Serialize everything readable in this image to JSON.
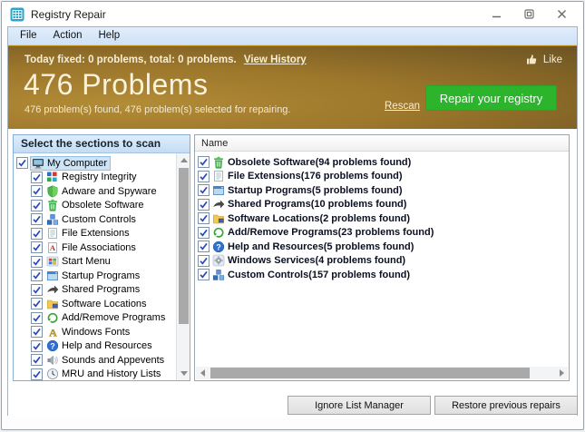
{
  "window": {
    "title": "Registry Repair"
  },
  "titlebar": {
    "app_icon": "registry-grid-icon",
    "controls": [
      {
        "name": "minimize-button",
        "icon": "minimize-icon"
      },
      {
        "name": "maximize-button",
        "icon": "maximize-icon"
      },
      {
        "name": "close-button",
        "icon": "close-icon"
      }
    ]
  },
  "menu": {
    "items": [
      "File",
      "Action",
      "Help"
    ]
  },
  "header": {
    "today_line": "Today fixed: 0 problems, total: 0 problems.",
    "view_history": "View History",
    "like_label": "Like",
    "big_title": "476 Problems",
    "subtitle": "476 problem(s) found, 476 problem(s) selected for repairing.",
    "rescan": "Rescan",
    "repair_button": "Repair your registry",
    "colors": {
      "accent_green": "#2cb52c",
      "brown_left": "#a9822f",
      "brown_right": "#6d5423",
      "text_cream": "#f7efd8"
    }
  },
  "left_panel": {
    "title": "Select the sections to scan",
    "tree": [
      {
        "label": "My Computer",
        "icon": "computer-icon",
        "checked": true,
        "indent": 0,
        "selected": true
      },
      {
        "label": "Registry Integrity",
        "icon": "registry-icon",
        "checked": true,
        "indent": 1
      },
      {
        "label": "Adware and Spyware",
        "icon": "shield-icon",
        "checked": true,
        "indent": 1
      },
      {
        "label": "Obsolete Software",
        "icon": "trash-icon",
        "checked": true,
        "indent": 1
      },
      {
        "label": "Custom Controls",
        "icon": "blocks-icon",
        "checked": true,
        "indent": 1
      },
      {
        "label": "File Extensions",
        "icon": "document-icon",
        "checked": true,
        "indent": 1
      },
      {
        "label": "File Associations",
        "icon": "document-a-icon",
        "checked": true,
        "indent": 1
      },
      {
        "label": "Start Menu",
        "icon": "windows-logo-icon",
        "checked": true,
        "indent": 1
      },
      {
        "label": "Startup Programs",
        "icon": "window-icon",
        "checked": true,
        "indent": 1
      },
      {
        "label": "Shared Programs",
        "icon": "share-arrow-icon",
        "checked": true,
        "indent": 1
      },
      {
        "label": "Software Locations",
        "icon": "folder-icon",
        "checked": true,
        "indent": 1
      },
      {
        "label": "Add/Remove Programs",
        "icon": "recycle-icon",
        "checked": true,
        "indent": 1
      },
      {
        "label": "Windows Fonts",
        "icon": "font-icon",
        "checked": true,
        "indent": 1
      },
      {
        "label": "Help and Resources",
        "icon": "help-icon",
        "checked": true,
        "indent": 1
      },
      {
        "label": "Sounds and Appevents",
        "icon": "speaker-icon",
        "checked": true,
        "indent": 1
      },
      {
        "label": "MRU and History Lists",
        "icon": "clock-icon",
        "checked": true,
        "indent": 1
      }
    ]
  },
  "right_panel": {
    "column_header": "Name",
    "items": [
      {
        "label": "Obsolete Software(94 problems found)",
        "icon": "trash-icon",
        "checked": true
      },
      {
        "label": "File Extensions(176 problems found)",
        "icon": "document-icon",
        "checked": true
      },
      {
        "label": "Startup Programs(5 problems found)",
        "icon": "window-icon",
        "checked": true
      },
      {
        "label": "Shared Programs(10 problems found)",
        "icon": "share-arrow-icon",
        "checked": true
      },
      {
        "label": "Software Locations(2 problems found)",
        "icon": "folder-icon",
        "checked": true
      },
      {
        "label": "Add/Remove Programs(23 problems found)",
        "icon": "recycle-icon",
        "checked": true
      },
      {
        "label": "Help and Resources(5 problems found)",
        "icon": "help-icon",
        "checked": true
      },
      {
        "label": "Windows Services(4 problems found)",
        "icon": "gear-icon",
        "checked": true
      },
      {
        "label": "Custom Controls(157 problems found)",
        "icon": "blocks-icon",
        "checked": true
      }
    ]
  },
  "footer": {
    "ignore_button": "Ignore List Manager",
    "restore_button": "Restore previous repairs"
  }
}
